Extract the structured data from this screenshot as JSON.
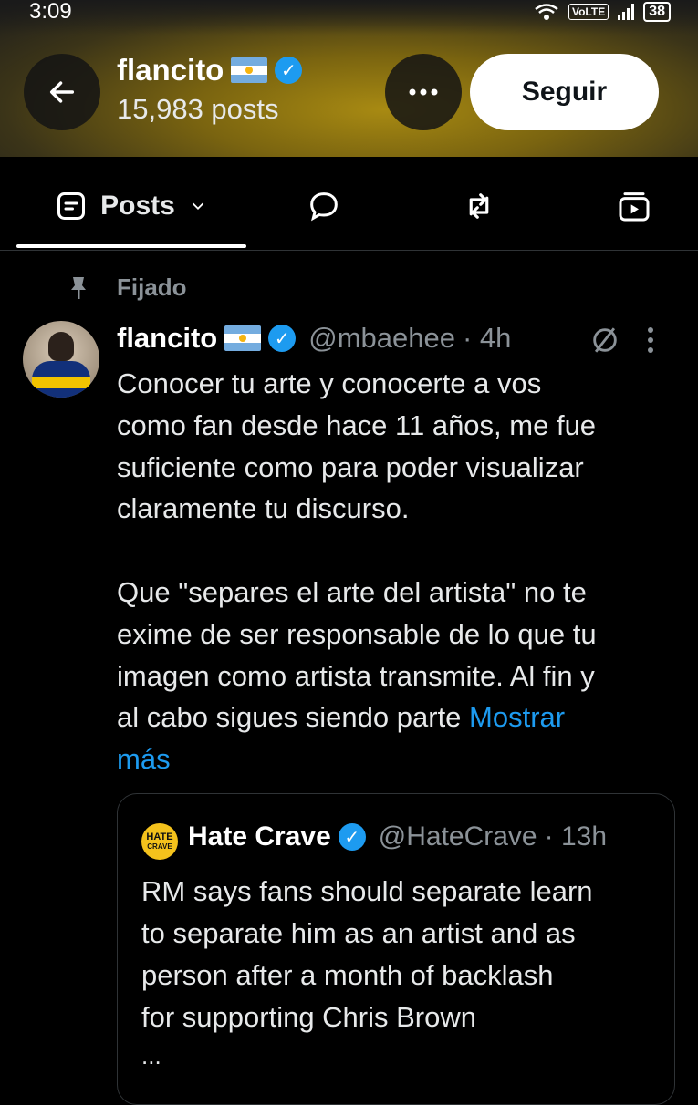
{
  "status_bar": {
    "time": "3:09",
    "network": "VoLTE",
    "battery": "38"
  },
  "profile": {
    "name": "flancito",
    "posts_count": "15,983 posts",
    "follow_label": "Seguir"
  },
  "tabs": {
    "posts_label": "Posts"
  },
  "pinned_label": "Fijado",
  "post": {
    "author": "flancito",
    "handle": "@mbaehee",
    "time": "· 4h",
    "text": "Conocer tu arte y conocerte a vos\ncomo fan desde hace 11 años, me fue\nsuficiente como para poder visualizar\nclaramente tu discurso.\n\nQue \"separes el arte del artista\" no te\nexime de ser responsable de lo que tu\nimagen como artista transmite. Al fin y\nal cabo sigues siendo parte ",
    "show_more": "Mostrar\nmás"
  },
  "quote": {
    "avatar_line1": "HATE",
    "avatar_line2": "CRAVE",
    "author": "Hate Crave",
    "handle": "@HateCrave",
    "time": "· 13h",
    "text": "RM says fans should separate learn\nto separate him as an artist and as\nperson after a month of backlash\nfor supporting Chris Brown",
    "ellipsis": "..."
  },
  "colors": {
    "accent": "#1d9bf0",
    "background": "#000000",
    "muted": "#8b9298"
  },
  "icons": [
    "back-arrow-icon",
    "more-icon",
    "verified-icon",
    "posts-icon",
    "chevron-down-icon",
    "reply-icon",
    "repost-icon",
    "video-icon",
    "pin-icon",
    "grok-icon",
    "kebab-icon"
  ]
}
